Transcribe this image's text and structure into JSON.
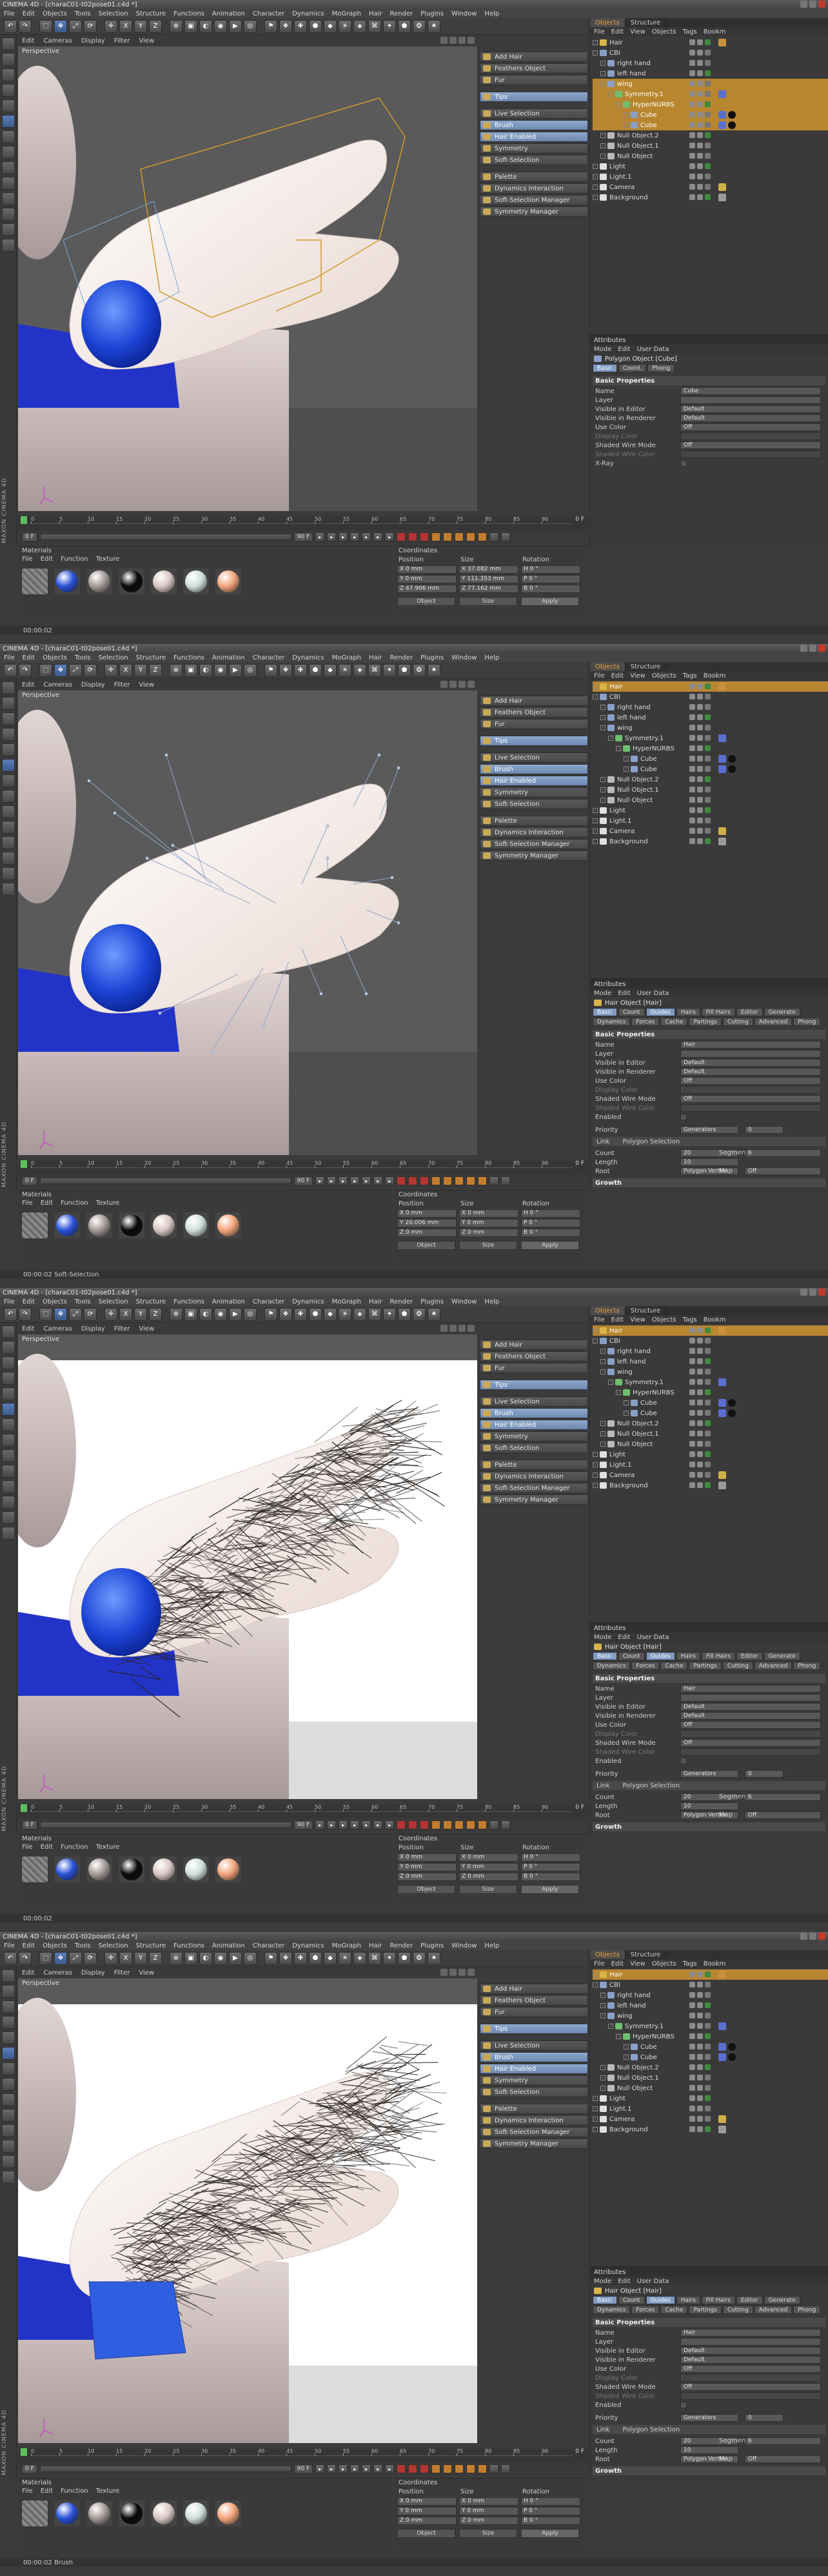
{
  "app": {
    "frame_titles": [
      "CINEMA 4D - [charaC01-t02pose01.c4d *]",
      "CINEMA 4D - [charaC01-t02pose01.c4d *]",
      "CINEMA 4D - [charaC01-t02pose01.c4d *]",
      "CINEMA 4D - [charaC01-t02pose01.c4d *]"
    ],
    "main_menu": [
      "File",
      "Edit",
      "Objects",
      "Tools",
      "Selection",
      "Structure",
      "Functions",
      "Animation",
      "Character",
      "Dynamics",
      "MoGraph",
      "Hair",
      "Render",
      "Plugins",
      "Window",
      "Help"
    ],
    "viewport_menu": [
      "Edit",
      "Cameras",
      "Display",
      "Filter",
      "View"
    ],
    "viewport_label": "Perspective",
    "brand_vertical": "MAXON CINEMA 4D"
  },
  "hair_palette": {
    "items": [
      "Add Hair",
      "Feathers Object",
      "Fur",
      "",
      "Tips",
      "",
      "Live Selection",
      "Brush",
      "Hair Enabled",
      "Symmetry",
      "Soft-Selection",
      "",
      "Palette",
      "Dynamics Interaction",
      "Soft-Selection Manager",
      "Symmetry Manager"
    ],
    "highlighted": [
      "Tips",
      "Brush",
      "Hair Enabled"
    ]
  },
  "object_manager": {
    "tabs": [
      "Objects",
      "Structure"
    ],
    "menu": [
      "File",
      "Edit",
      "View",
      "Objects",
      "Tags",
      "Bookm"
    ],
    "frames": [
      {
        "rows": [
          {
            "label": "Hair",
            "indent": 0,
            "color": "#d9b44a"
          },
          {
            "label": "CBI",
            "indent": 0,
            "color": "#8aa0c8"
          },
          {
            "label": "right hand",
            "indent": 1,
            "color": "#8aa0c8"
          },
          {
            "label": "left hand",
            "indent": 1,
            "color": "#8aa0c8"
          },
          {
            "label": "wing",
            "indent": 1,
            "color": "#8aa0c8",
            "sel": true
          },
          {
            "label": "Symmetry.1",
            "indent": 2,
            "color": "#6fbf6f",
            "sel": true
          },
          {
            "label": "HyperNURBS",
            "indent": 3,
            "color": "#6fbf6f",
            "sel": true
          },
          {
            "label": "Cube",
            "indent": 4,
            "color": "#8aa0c8",
            "sel": true
          },
          {
            "label": "Cube",
            "indent": 4,
            "color": "#8aa0c8",
            "sel": true
          },
          {
            "label": "Null Object.2",
            "indent": 1,
            "color": "#bbbbbb"
          },
          {
            "label": "Null Object.1",
            "indent": 1,
            "color": "#bbbbbb"
          },
          {
            "label": "Null Object",
            "indent": 1,
            "color": "#bbbbbb"
          },
          {
            "label": "Light",
            "indent": 0,
            "color": "#e0e0e0"
          },
          {
            "label": "Light.1",
            "indent": 0,
            "color": "#e0e0e0"
          },
          {
            "label": "Camera",
            "indent": 0,
            "color": "#e0e0e0"
          },
          {
            "label": "Background",
            "indent": 0,
            "color": "#e0e0e0"
          }
        ]
      },
      {
        "rows": [
          {
            "label": "Hair",
            "indent": 0,
            "color": "#d9b44a",
            "sel": true
          },
          {
            "label": "CBI",
            "indent": 0,
            "color": "#8aa0c8"
          },
          {
            "label": "right hand",
            "indent": 1,
            "color": "#8aa0c8"
          },
          {
            "label": "left hand",
            "indent": 1,
            "color": "#8aa0c8"
          },
          {
            "label": "wing",
            "indent": 1,
            "color": "#8aa0c8"
          },
          {
            "label": "Symmetry.1",
            "indent": 2,
            "color": "#6fbf6f"
          },
          {
            "label": "HyperNURBS",
            "indent": 3,
            "color": "#6fbf6f"
          },
          {
            "label": "Cube",
            "indent": 4,
            "color": "#8aa0c8"
          },
          {
            "label": "Cube",
            "indent": 4,
            "color": "#8aa0c8"
          },
          {
            "label": "Null Object.2",
            "indent": 1,
            "color": "#bbbbbb"
          },
          {
            "label": "Null Object.1",
            "indent": 1,
            "color": "#bbbbbb"
          },
          {
            "label": "Null Object",
            "indent": 1,
            "color": "#bbbbbb"
          },
          {
            "label": "Light",
            "indent": 0,
            "color": "#e0e0e0"
          },
          {
            "label": "Light.1",
            "indent": 0,
            "color": "#e0e0e0"
          },
          {
            "label": "Camera",
            "indent": 0,
            "color": "#e0e0e0"
          },
          {
            "label": "Background",
            "indent": 0,
            "color": "#e0e0e0"
          }
        ]
      }
    ]
  },
  "attributes": {
    "header": "Attributes",
    "menu": [
      "Mode",
      "Edit",
      "User Data"
    ],
    "cube": {
      "object_title": "Polygon Object [Cube]",
      "tabs": [
        "Basic",
        "Coord.",
        "Phong"
      ],
      "section": "Basic Properties",
      "props": [
        {
          "label": "Name",
          "value": "Cube"
        },
        {
          "label": "Layer",
          "value": ""
        },
        {
          "label": "Visible in Editor",
          "value": "Default"
        },
        {
          "label": "Visible in Renderer",
          "value": "Default"
        },
        {
          "label": "Use Color",
          "value": "Off"
        },
        {
          "label": "Display Color",
          "value": "",
          "dim": true
        },
        {
          "label": "Shaded Wire Mode",
          "value": "Off"
        },
        {
          "label": "Shaded Wire Color",
          "value": "",
          "dim": true
        },
        {
          "label": "X-Ray",
          "value": "",
          "check": true
        }
      ]
    },
    "hair": {
      "object_title": "Hair Object [Hair]",
      "tabs": [
        "Basic",
        "Count",
        "Guides",
        "Hairs",
        "Fill Hairs",
        "Editor",
        "Generate",
        "Dynamics",
        "Forces",
        "Cache",
        "Partings",
        "Cutting",
        "Advanced",
        "Phong"
      ],
      "active_tab": "Guides",
      "section": "Basic Properties",
      "props": [
        {
          "label": "Name",
          "value": "Hair"
        },
        {
          "label": "Layer",
          "value": ""
        },
        {
          "label": "Visible in Editor",
          "value": "Default"
        },
        {
          "label": "Visible in Renderer",
          "value": "Default"
        },
        {
          "label": "Use Color",
          "value": "Off"
        },
        {
          "label": "Display Color",
          "value": "",
          "dim": true
        },
        {
          "label": "Shaded Wire Mode",
          "value": "Off"
        },
        {
          "label": "Shaded Wire Color",
          "value": "",
          "dim": true
        },
        {
          "label": "Enabled",
          "value": "",
          "check": true
        }
      ],
      "priority_label": "Priority",
      "priority_value": "Generators",
      "priority_num": "0",
      "link_label": "Link",
      "link_value": "Polygon Selection",
      "count_label": "Count",
      "count_value": "20",
      "segments_label": "Segments",
      "segments_value": "6",
      "length_label": "Length",
      "length_value": "10",
      "root_label": "Root",
      "root_value": "Polygon Vertex",
      "map_label": "Map",
      "map_value": "Off",
      "growth_label": "Growth"
    }
  },
  "timeline": {
    "ticks": [
      "0",
      "5",
      "10",
      "15",
      "20",
      "25",
      "30",
      "35",
      "40",
      "45",
      "50",
      "55",
      "60",
      "65",
      "70",
      "75",
      "80",
      "85",
      "90"
    ],
    "end_label": "0 F",
    "start_field": "0 F",
    "end_field": "90 F"
  },
  "materials": {
    "title": "Materials",
    "menu": [
      "File",
      "Edit",
      "Function",
      "Texture"
    ],
    "balls": [
      {
        "color": "#777777",
        "pattern": true
      },
      {
        "color": "#2a52d8"
      },
      {
        "color": "#a49a98"
      },
      {
        "color": "#0a0a0a"
      },
      {
        "color": "#d9c7c4"
      },
      {
        "color": "#cfe0d8"
      },
      {
        "color": "#f2a57a"
      }
    ]
  },
  "coordinates": {
    "title": "Coordinates",
    "headers": [
      "Position",
      "Size",
      "Rotation"
    ],
    "frames": [
      {
        "rows": [
          [
            "X 0 mm",
            "X 37.082 mm",
            "H 0 °"
          ],
          [
            "Y 0 mm",
            "Y 111.353 mm",
            "P 0 °"
          ],
          [
            "Z 47.906 mm",
            "Z 77.162 mm",
            "B 0 °"
          ]
        ]
      },
      {
        "rows": [
          [
            "X 0 mm",
            "X 0 mm",
            "H 0 °"
          ],
          [
            "Y 20.006 mm",
            "Y 0 mm",
            "P 0 °"
          ],
          [
            "Z 0 mm",
            "Z 0 mm",
            "B 0 °"
          ]
        ]
      },
      {
        "rows": [
          [
            "X 0 mm",
            "X 0 mm",
            "H 0 °"
          ],
          [
            "Y 0 mm",
            "Y 0 mm",
            "P 0 °"
          ],
          [
            "Z 0 mm",
            "Z 0 mm",
            "B 0 °"
          ]
        ]
      }
    ],
    "mode_object": "Object",
    "mode_size": "Size",
    "apply": "Apply"
  },
  "status": [
    "00:00:02",
    "00:00:02  Soft-Selection",
    "00:00:02",
    "00:00:02  Brush"
  ]
}
